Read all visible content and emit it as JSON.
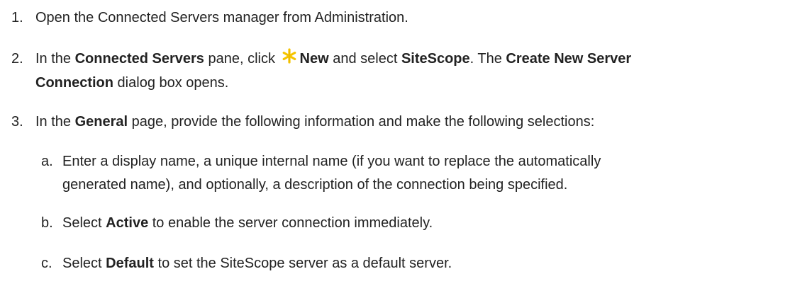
{
  "steps": [
    {
      "number": "1.",
      "text": "Open the Connected Servers manager from Administration."
    },
    {
      "number": "2.",
      "t1": "In the ",
      "b1": "Connected Servers",
      "t2": " pane, click ",
      "icon": "new-asterisk-icon",
      "b2": "New",
      "t3": " and select ",
      "b3": "SiteScope",
      "t4": ". The ",
      "b4": "Create New Server",
      "b5": "Connection",
      "t5": " dialog box opens."
    },
    {
      "number": "3.",
      "t1": "In the ",
      "b1": "General",
      "t2": " page, provide the following information and make the following selections:"
    }
  ],
  "substeps": [
    {
      "letter": "a.",
      "line1": "Enter a display name, a unique internal name (if you want to replace the automatically",
      "line2": "generated name), and optionally, a description of the connection being specified."
    },
    {
      "letter": "b.",
      "t1": "Select ",
      "b1": "Active",
      "t2": " to enable the server connection immediately."
    },
    {
      "letter": "c.",
      "t1": "Select ",
      "b1": "Default",
      "t2": " to set the SiteScope server as a default server."
    }
  ],
  "colors": {
    "text": "#222222",
    "icon": "#f5c400",
    "background": "#ffffff"
  }
}
